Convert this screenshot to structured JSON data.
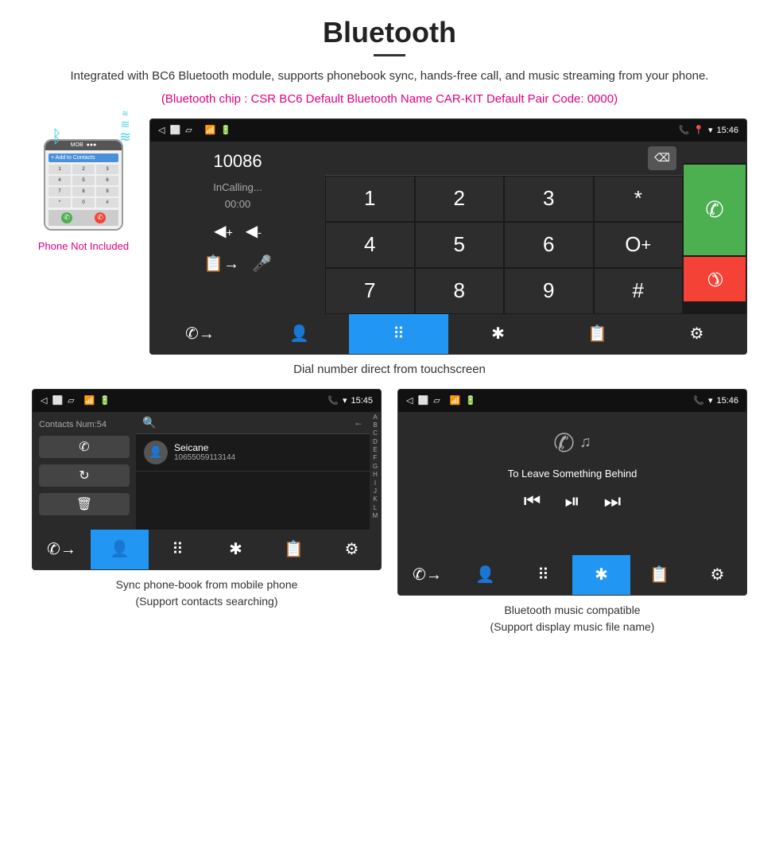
{
  "header": {
    "title": "Bluetooth",
    "description": "Integrated with BC6 Bluetooth module, supports phonebook sync, hands-free call, and music streaming from your phone.",
    "specs": "(Bluetooth chip : CSR BC6    Default Bluetooth Name CAR-KIT    Default Pair Code: 0000)"
  },
  "main_screen": {
    "status_bar": {
      "left_icons": [
        "◁",
        "⬜",
        "▱"
      ],
      "right_icons": [
        "📞",
        "📍",
        "▾"
      ],
      "time": "15:46"
    },
    "dial_number": "10086",
    "calling_label": "InCalling...",
    "timer": "00:00",
    "vol_up": "◀+",
    "vol_down": "◀-",
    "speaker_icon": "🔊",
    "mute_icon": "🎤",
    "numpad": [
      {
        "label": "1"
      },
      {
        "label": "2"
      },
      {
        "label": "3"
      },
      {
        "label": "*"
      },
      {
        "label": "call"
      },
      {
        "label": "4"
      },
      {
        "label": "5"
      },
      {
        "label": "6"
      },
      {
        "label": "0+"
      },
      {
        "label": ""
      },
      {
        "label": "7"
      },
      {
        "label": "8"
      },
      {
        "label": "9"
      },
      {
        "label": "#"
      },
      {
        "label": "end"
      }
    ],
    "bottom_nav": [
      {
        "icon": "📞",
        "label": "dial",
        "active": false
      },
      {
        "icon": "👤",
        "label": "contacts",
        "active": false
      },
      {
        "icon": "⠿",
        "label": "numpad",
        "active": true
      },
      {
        "icon": "✱",
        "label": "bluetooth",
        "active": false
      },
      {
        "icon": "📋",
        "label": "transfer",
        "active": false
      },
      {
        "icon": "⚙",
        "label": "settings",
        "active": false
      }
    ],
    "caption": "Dial number direct from touchscreen"
  },
  "phone_illustration": {
    "not_included": "Phone Not Included"
  },
  "contacts_screen": {
    "status_bar_time": "15:45",
    "contacts_num": "Contacts Num:54",
    "search_placeholder": "Search...",
    "contact_name": "Seicane",
    "contact_number": "10655059113144",
    "alpha_letters": [
      "A",
      "B",
      "C",
      "D",
      "E",
      "F",
      "G",
      "H",
      "I",
      "J",
      "K",
      "L",
      "M"
    ],
    "bottom_nav_active": "contacts",
    "caption_line1": "Sync phone-book from mobile phone",
    "caption_line2": "(Support contacts searching)"
  },
  "music_screen": {
    "status_bar_time": "15:46",
    "song_title": "To Leave Something Behind",
    "caption_line1": "Bluetooth music compatible",
    "caption_line2": "(Support display music file name)"
  }
}
